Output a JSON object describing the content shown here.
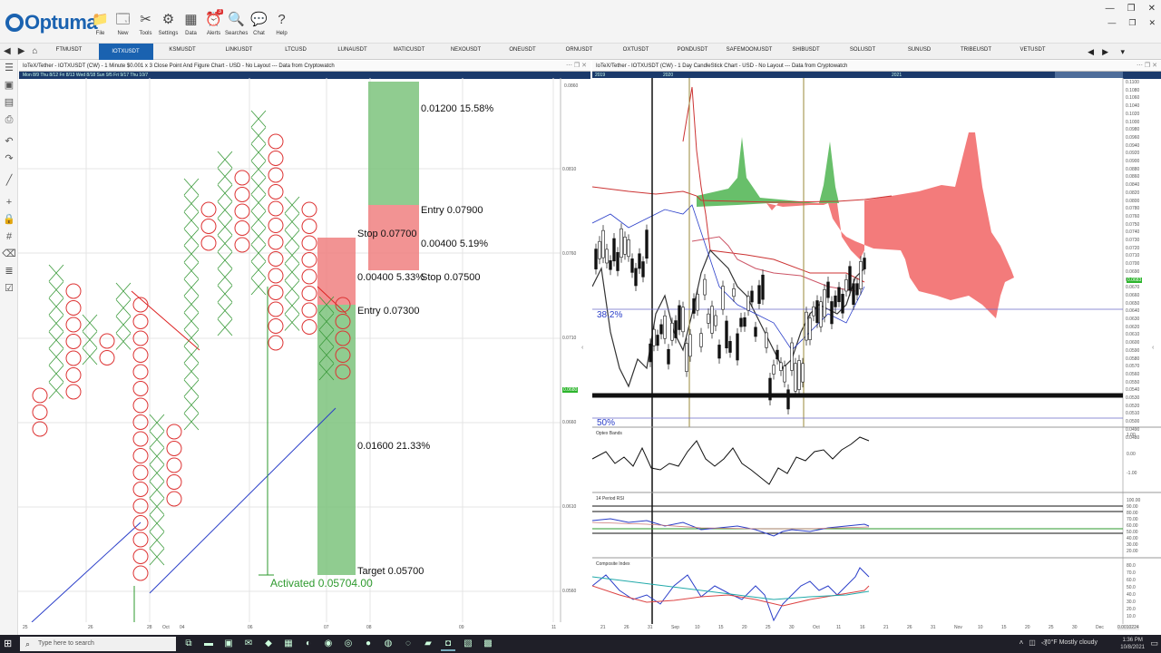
{
  "app": {
    "name": "Optuma"
  },
  "toolbar": [
    {
      "label": "File",
      "icon": "folder-icon",
      "glyph": "📁"
    },
    {
      "label": "New",
      "icon": "new-window-icon",
      "glyph": "🗔"
    },
    {
      "label": "Tools",
      "icon": "tools-icon",
      "glyph": "✂"
    },
    {
      "label": "Settings",
      "icon": "gear-icon",
      "glyph": "⚙"
    },
    {
      "label": "Data",
      "icon": "data-icon",
      "glyph": "▦"
    },
    {
      "label": "Alerts",
      "icon": "alarm-clock-icon",
      "glyph": "⏰",
      "badge": "3"
    },
    {
      "label": "Searches",
      "icon": "search-icon",
      "glyph": "🔍"
    },
    {
      "label": "Chat",
      "icon": "chat-icon",
      "glyph": "💬"
    },
    {
      "label": "Help",
      "icon": "help-icon",
      "glyph": "?"
    }
  ],
  "window_controls": {
    "minimize": "—",
    "restore": "❐",
    "close": "✕"
  },
  "tabs": [
    "FTMUSDT",
    "IOTXUSDT",
    "KSMUSDT",
    "LINKUSDT",
    "LTCUSD",
    "LUNAUSDT",
    "MATICUSDT",
    "NEXOUSDT",
    "ONEUSDT",
    "ORNUSDT",
    "OXTUSDT",
    "PONDUSDT",
    "SAFEMOONUSDT",
    "SHIBUSDT",
    "SOLUSDT",
    "SUNUSD",
    "TRIBEUSDT",
    "VETUSDT"
  ],
  "active_tab": "IOTXUSDT",
  "left_panel": {
    "title": "IoTeX/Tether - IOTXUSDT (CW) - 1 Minute $0.001 x 3 Close Point And Figure Chart - USD - No Layout --- Data from Cryptowatch",
    "date_bar": "Mon 8/9 Thu 8/12 Fri 8/13 Wed 8/18 Sun 9/5 Fri 9/17 Thu 10/7",
    "labels": {
      "t_target1": "0.01200 15.58%",
      "t_entry1": "Entry 0.07900",
      "t_stop1": "Stop 0.07700",
      "t_pct1": "0.00400 5.19%",
      "t_pct2a": "0.00400 5.33%",
      "t_stop2": "Stop 0.07500",
      "t_entry2": "Entry 0.07300",
      "t_target2": "0.01600 21.33%",
      "t_tgt": "Target 0.05700",
      "t_act": "Activated 0.05704.00"
    },
    "price_axis": [
      "0.0860",
      "0.0810",
      "0.0760",
      "0.0710",
      "0.0660",
      "0.0610",
      "0.0560"
    ],
    "current_price": "0.0680",
    "x_axis": [
      "25",
      "26",
      "28",
      "Oct",
      "04",
      "06",
      "07",
      "08",
      "09",
      "11"
    ]
  },
  "right_panel": {
    "title": "IoTeX/Tether - IOTXUSDT (CW) - 1 Day CandleStick Chart - USD - No Layout --- Data from Cryptowatch",
    "date_bar": [
      "2019",
      "2020",
      "2021"
    ],
    "fib_labels": {
      "f1": "38.2%",
      "f2": "50%"
    },
    "price_axis": [
      "0.1100",
      "0.1080",
      "0.1060",
      "0.1040",
      "0.1020",
      "0.1000",
      "0.0980",
      "0.0960",
      "0.0940",
      "0.0920",
      "0.0900",
      "0.0880",
      "0.0860",
      "0.0840",
      "0.0820",
      "0.0800",
      "0.0780",
      "0.0760",
      "0.0750",
      "0.0740",
      "0.0730",
      "0.0720",
      "0.0710",
      "0.0700",
      "0.0690",
      "0.0680",
      "0.0670",
      "0.0660",
      "0.0650",
      "0.0640",
      "0.0630",
      "0.0620",
      "0.0610",
      "0.0600",
      "0.0590",
      "0.0580",
      "0.0570",
      "0.0560",
      "0.0550",
      "0.0540",
      "0.0530",
      "0.0520",
      "0.0510",
      "0.0500",
      "0.0490",
      "0.0480"
    ],
    "current_price": "0.0683",
    "indicators": [
      {
        "name": "Optex Bands",
        "axis": [
          "1.00",
          "0.00",
          "-1.00"
        ]
      },
      {
        "name": "14 Period RSI",
        "axis": [
          "100.00",
          "90.00",
          "80.00",
          "70.00",
          "60.00",
          "50.00",
          "40.00",
          "30.00",
          "20.00"
        ]
      },
      {
        "name": "Composite Index",
        "axis": [
          "80.0",
          "70.0",
          "60.0",
          "50.0",
          "40.0",
          "30.0",
          "20.0",
          "10.0"
        ]
      }
    ],
    "x_axis": [
      "21",
      "26",
      "31",
      "Sep",
      "10",
      "15",
      "20",
      "25",
      "30",
      "Oct",
      "11",
      "16",
      "21",
      "26",
      "31",
      "Nov",
      "10",
      "15",
      "20",
      "25",
      "30",
      "Dec"
    ],
    "corner_value": "0.0010224"
  },
  "taskbar": {
    "search_placeholder": "Type here to search",
    "weather": "70°F  Mostly cloudy",
    "time": "1:36 PM",
    "date": "10/8/2021"
  }
}
